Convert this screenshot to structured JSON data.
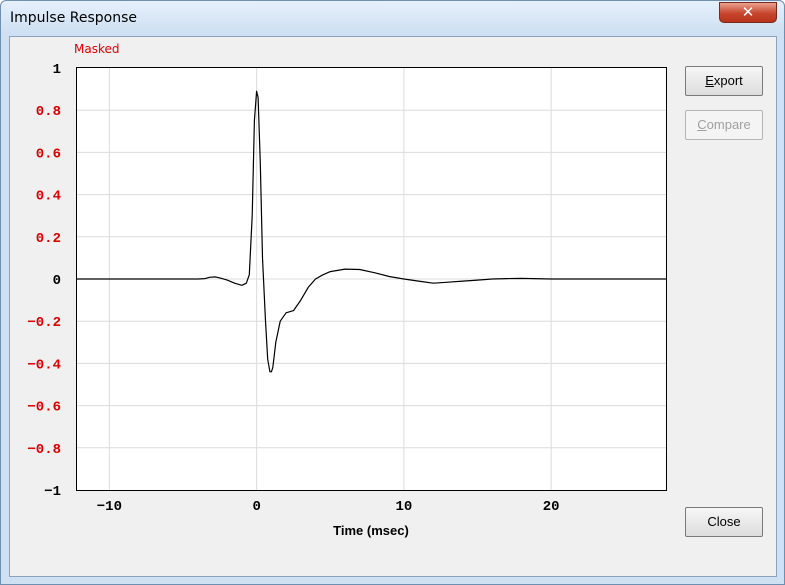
{
  "window": {
    "title": "Impulse Response",
    "close_glyph": "✕"
  },
  "status": {
    "masked_label": "Masked"
  },
  "buttons": {
    "export": "Export",
    "compare": "Compare",
    "close": "Close"
  },
  "colors": {
    "y_tick": "#e00000",
    "masked": "#e00000",
    "trace": "#000000",
    "grid": "#dcdcdc"
  },
  "chart_data": {
    "type": "line",
    "xlabel": "Time (msec)",
    "xlim": [
      -12.2,
      27.8
    ],
    "ylim": [
      -1,
      1
    ],
    "xticks": [
      -10,
      0,
      10,
      20
    ],
    "xtick_labels": [
      "−10",
      "0",
      "10",
      "20"
    ],
    "yticks": [
      1,
      0.8,
      0.6,
      0.4,
      0.2,
      0,
      -0.2,
      -0.4,
      -0.6,
      -0.8,
      -1
    ],
    "ytick_labels": [
      "1",
      "0.8",
      "0.6",
      "0.4",
      "0.2",
      "0",
      "−0.2",
      "−0.4",
      "−0.6",
      "−0.8",
      "−1"
    ],
    "ytick_colors": [
      "#000000",
      "#e00000",
      "#e00000",
      "#e00000",
      "#e00000",
      "#000000",
      "#e00000",
      "#e00000",
      "#e00000",
      "#e00000",
      "#000000"
    ],
    "grid": true,
    "series": [
      {
        "x": [
          -12.2,
          -4,
          -3.5,
          -3.2,
          -2.8,
          -2.5,
          -2.0,
          -1.5,
          -1.0,
          -0.7,
          -0.5,
          -0.3,
          -0.15,
          0,
          0.1,
          0.25,
          0.4,
          0.6,
          0.75,
          0.9,
          1.0,
          1.1,
          1.3,
          1.6,
          2.0,
          2.5,
          3.0,
          3.5,
          4.0,
          4.5,
          5.0,
          6.0,
          7.0,
          8.0,
          9.0,
          10.0,
          11.0,
          12.0,
          13.0,
          14.0,
          15.0,
          16.0,
          17.0,
          18.0,
          20.0,
          22.0,
          27.8
        ],
        "y": [
          0,
          0,
          0.002,
          0.008,
          0.01,
          0.005,
          -0.005,
          -0.02,
          -0.03,
          -0.02,
          0.02,
          0.3,
          0.75,
          0.89,
          0.86,
          0.55,
          0.1,
          -0.2,
          -0.38,
          -0.44,
          -0.44,
          -0.42,
          -0.3,
          -0.2,
          -0.16,
          -0.15,
          -0.1,
          -0.04,
          0,
          0.02,
          0.035,
          0.047,
          0.045,
          0.03,
          0.012,
          0,
          -0.01,
          -0.02,
          -0.015,
          -0.01,
          -0.005,
          0,
          0.002,
          0.003,
          0,
          0,
          0
        ]
      }
    ]
  }
}
